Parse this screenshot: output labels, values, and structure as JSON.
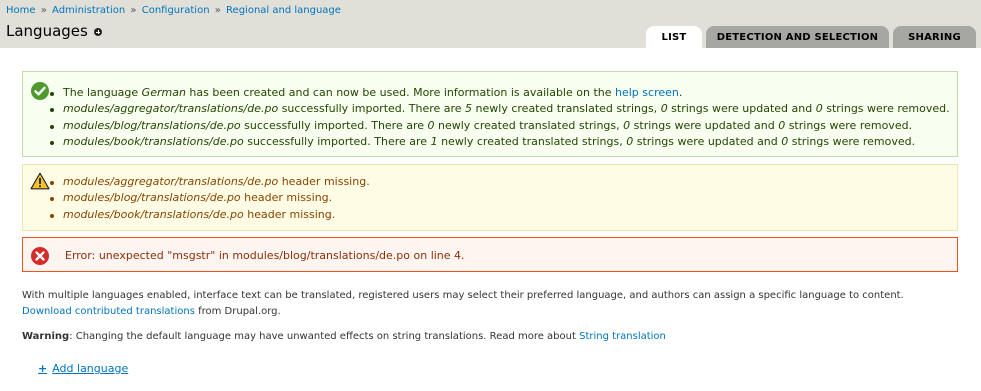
{
  "breadcrumb": {
    "items": [
      "Home",
      "Administration",
      "Configuration",
      "Regional and language"
    ],
    "separator": "»"
  },
  "page": {
    "title": "Languages"
  },
  "tabs": [
    {
      "label": "LIST",
      "active": true
    },
    {
      "label": "DETECTION AND SELECTION",
      "active": false
    },
    {
      "label": "SHARING",
      "active": false
    }
  ],
  "messages": {
    "status": {
      "icon": "check-circle-icon",
      "items": [
        {
          "a": "The language ",
          "lang": "German",
          "b": " has been created and can now be used. More information is available on the ",
          "link": "help screen",
          "c": "."
        },
        {
          "file": "modules/aggregator/translations/de.po",
          "a": " successfully imported. There are ",
          "new": "5",
          "b": " newly created translated strings, ",
          "updated": "0",
          "c": " strings were updated and ",
          "removed": "0",
          "d": " strings were removed."
        },
        {
          "file": "modules/blog/translations/de.po",
          "a": " successfully imported. There are ",
          "new": "0",
          "b": " newly created translated strings, ",
          "updated": "0",
          "c": " strings were updated and ",
          "removed": "0",
          "d": " strings were removed."
        },
        {
          "file": "modules/book/translations/de.po",
          "a": " successfully imported. There are ",
          "new": "1",
          "b": " newly created translated strings, ",
          "updated": "0",
          "c": " strings were updated and ",
          "removed": "0",
          "d": " strings were removed."
        }
      ]
    },
    "warning": {
      "icon": "warning-triangle-icon",
      "items": [
        {
          "file": "modules/aggregator/translations/de.po",
          "text": " header missing."
        },
        {
          "file": "modules/blog/translations/de.po",
          "text": " header missing."
        },
        {
          "file": "modules/book/translations/de.po",
          "text": " header missing."
        }
      ]
    },
    "error": {
      "icon": "error-x-circle-icon",
      "text": "Error: unexpected \"msgstr\" in modules/blog/translations/de.po on line 4."
    }
  },
  "help": {
    "p1_text": "With multiple languages enabled, interface text can be translated, registered users may select their preferred language, and authors can assign a specific language to content. ",
    "p1_link": "Download contributed translations",
    "p1_after": " from Drupal.org.",
    "p2_label": "Warning",
    "p2_text": ": Changing the default language may have unwanted effects on string translations. Read more about ",
    "p2_link": "String translation"
  },
  "actions": {
    "add_icon": "+",
    "add_label": "Add language"
  },
  "colors": {
    "link": "#0074bd",
    "header_bg": "#e0e0d8",
    "status_bg": "#f8fff0",
    "warning_bg": "#fffce5",
    "error_border": "#ed541d"
  }
}
